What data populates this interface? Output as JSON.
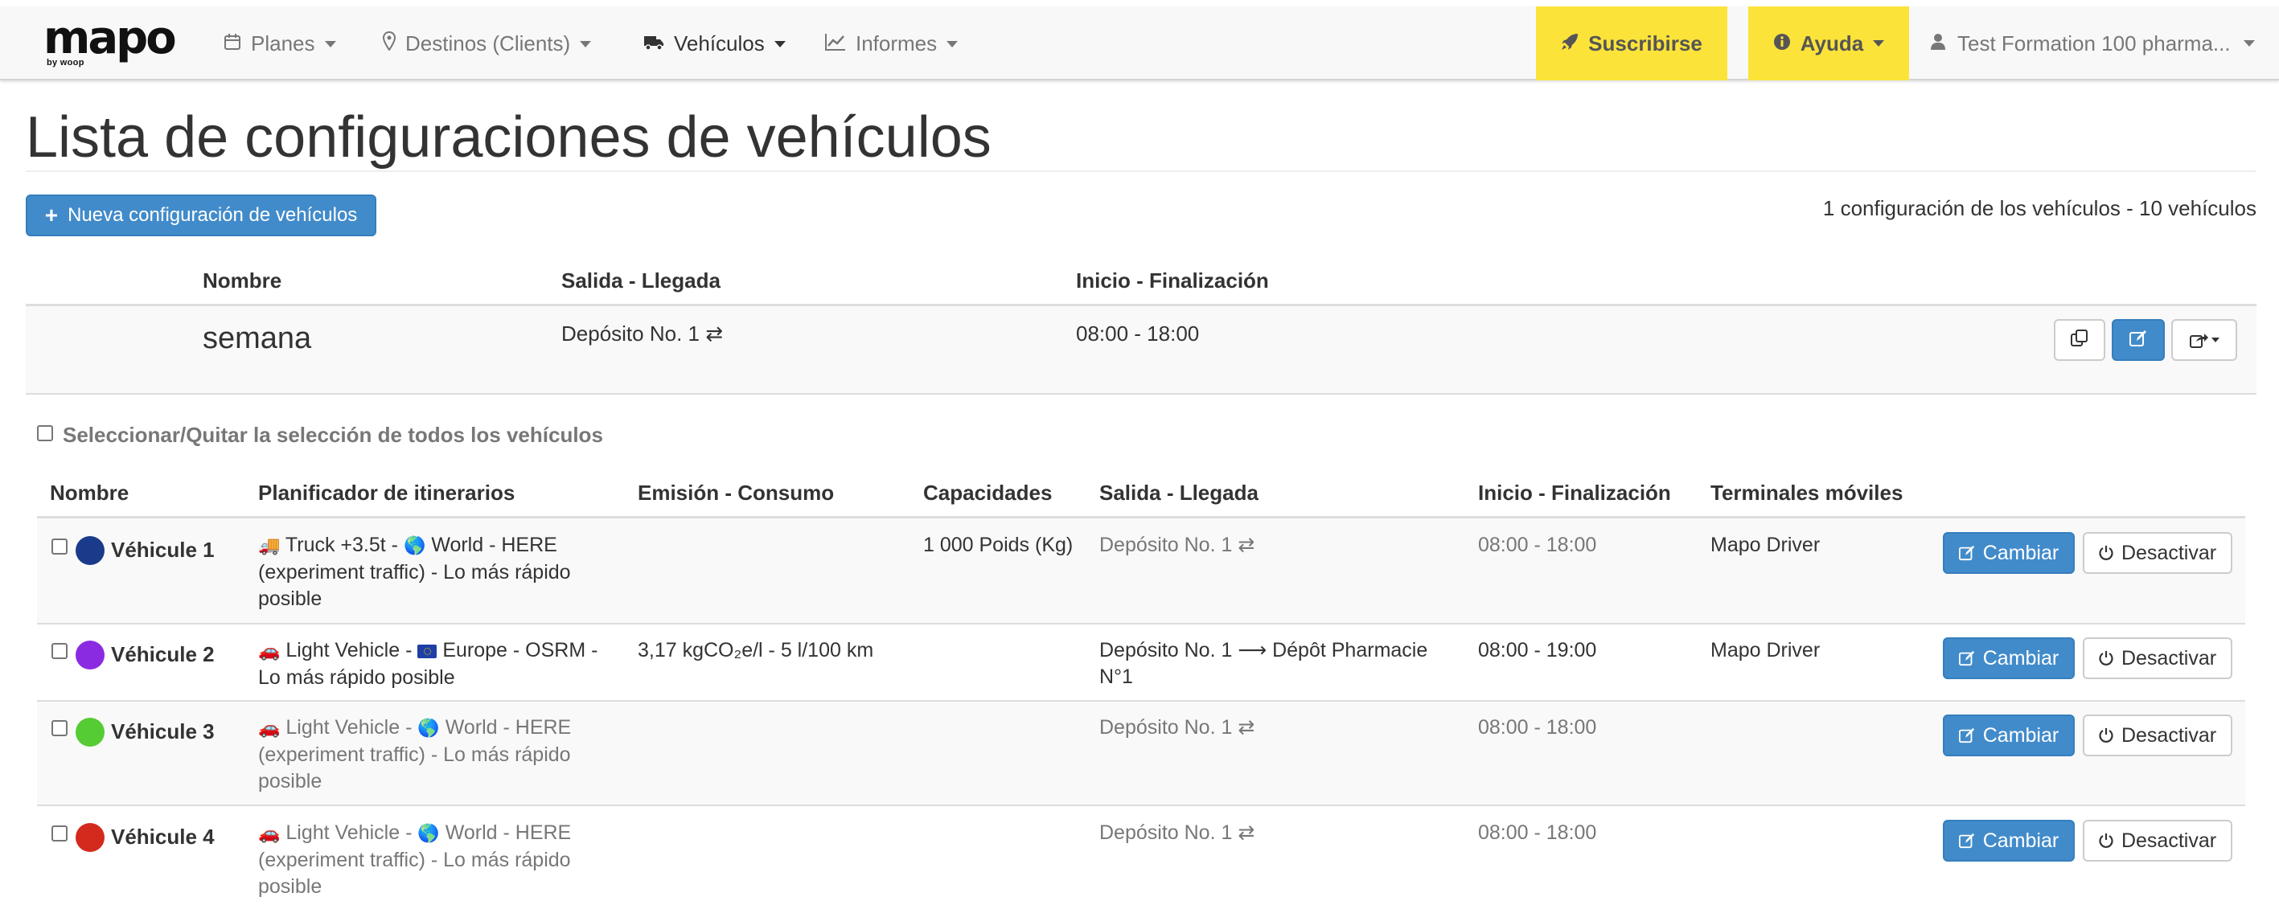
{
  "brand": {
    "name": "mapo",
    "sub": "by woop"
  },
  "nav": {
    "planes": "Planes",
    "destinos": "Destinos (Clients)",
    "vehiculos": "Vehículos",
    "informes": "Informes",
    "suscribirse": "Suscribirse",
    "ayuda": "Ayuda",
    "user": "Test Formation 100 pharma..."
  },
  "page": {
    "title": "Lista de configuraciones de vehículos",
    "new_button": "Nueva configuración de vehículos",
    "summary": "1 configuración de los vehículos - 10 vehículos"
  },
  "config_table": {
    "headers": {
      "nombre": "Nombre",
      "salida": "Salida - Llegada",
      "inicio": "Inicio - Finalización"
    },
    "row": {
      "nombre": "semana",
      "salida": "Depósito No. 1 ⇄",
      "inicio": "08:00 - 18:00"
    }
  },
  "select_all": "Seleccionar/Quitar la selección de todos los vehículos",
  "vehicle_table": {
    "headers": {
      "nombre": "Nombre",
      "planificador": "Planificador de itinerarios",
      "emision": "Emisión - Consumo",
      "capacidades": "Capacidades",
      "salida": "Salida - Llegada",
      "inicio": "Inicio - Finalización",
      "terminales": "Terminales móviles"
    },
    "cambiar_label": "Cambiar",
    "desactivar_label": "Desactivar",
    "rows": [
      {
        "nombre": "Véhicule 1",
        "color": "#1a3a8a",
        "plan_line1": "Truck +3.5t - ",
        "plan_line1b": "World - HERE",
        "plan_line2": "(experiment traffic) - Lo más rápido",
        "plan_line3": "posible",
        "plan_icon": "truck-icon",
        "emision": "",
        "capacidades": "1 000 Poids (Kg)",
        "salida": "Depósito No. 1 ⇄",
        "salida2": "",
        "inicio": "08:00 - 18:00",
        "terminal": "Mapo Driver"
      },
      {
        "nombre": "Véhicule 2",
        "color": "#8a2be2",
        "plan_line1": "Light Vehicle - ",
        "plan_line1b": "Europe - OSRM -",
        "plan_line2": "Lo más rápido posible",
        "plan_line3": "",
        "plan_icon": "car-icon",
        "emision": "3,17 kgCO₂e/l - 5 l/100 km",
        "capacidades": "",
        "salida": "Depósito No. 1 ⟶ Dépôt Pharmacie",
        "salida2": "N°1",
        "inicio": "08:00 - 19:00",
        "terminal": "Mapo Driver"
      },
      {
        "nombre": "Véhicule 3",
        "color": "#55cc33",
        "plan_line1": "Light Vehicle - ",
        "plan_line1b": "World - HERE",
        "plan_line2": "(experiment traffic) - Lo más rápido",
        "plan_line3": "posible",
        "plan_icon": "car-icon",
        "emision": "",
        "capacidades": "",
        "salida": "Depósito No. 1 ⇄",
        "salida2": "",
        "inicio": "08:00 - 18:00",
        "terminal": ""
      },
      {
        "nombre": "Véhicule 4",
        "color": "#d42a1e",
        "plan_line1": "Light Vehicle - ",
        "plan_line1b": "World - HERE",
        "plan_line2": "(experiment traffic) - Lo más rápido",
        "plan_line3": "posible",
        "plan_icon": "car-icon",
        "emision": "",
        "capacidades": "",
        "salida": "Depósito No. 1 ⇄",
        "salida2": "",
        "inicio": "08:00 - 18:00",
        "terminal": ""
      }
    ]
  },
  "colors": {
    "primary": "#428bca",
    "yellow": "#fbe33a"
  }
}
